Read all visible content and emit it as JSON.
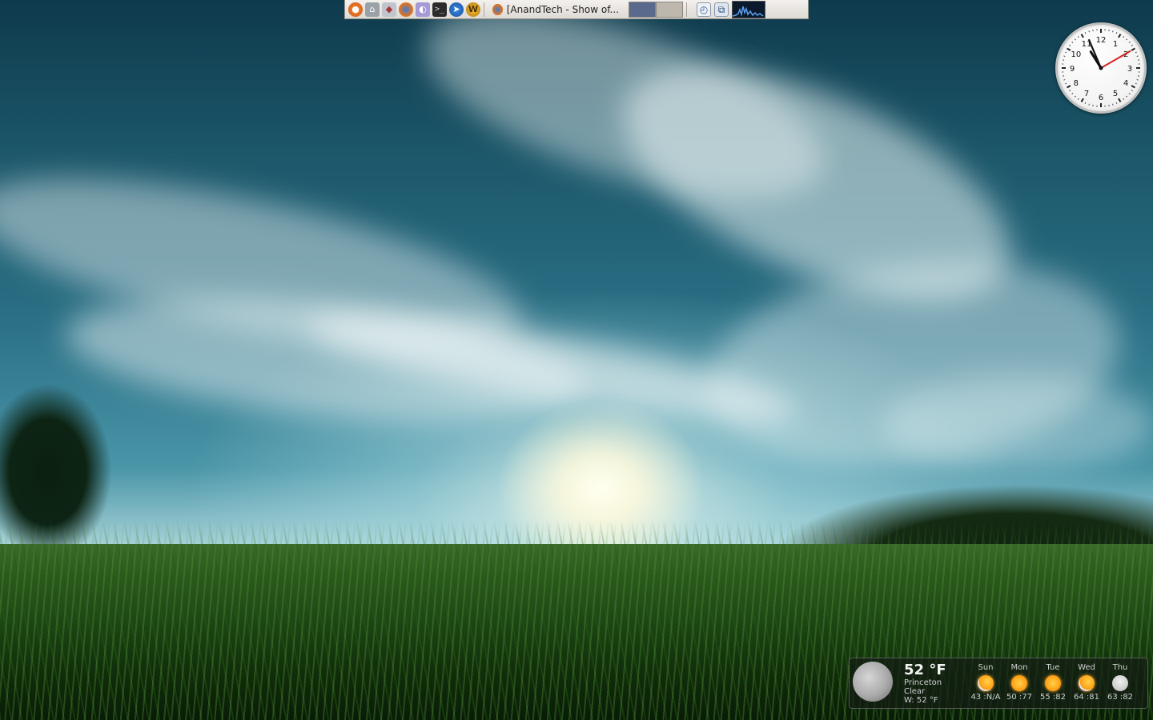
{
  "panel": {
    "launchers": [
      {
        "name": "ubuntu-menu-icon"
      },
      {
        "name": "home-folder-icon"
      },
      {
        "name": "network-places-icon"
      },
      {
        "name": "firefox-icon"
      },
      {
        "name": "pidgin-icon"
      },
      {
        "name": "terminal-icon"
      },
      {
        "name": "compass-browser-icon"
      },
      {
        "name": "world-of-warcraft-icon"
      }
    ],
    "task": {
      "icon": "firefox-icon",
      "title": "[AnandTech - Show of..."
    },
    "pager_colors": [
      "#5a6a8c",
      "#bdb7ae"
    ],
    "tray": [
      {
        "name": "clock-applet-icon"
      },
      {
        "name": "network-applet-icon"
      },
      {
        "name": "network-monitor-graph"
      }
    ]
  },
  "clock": {
    "numbers": [
      "12",
      "1",
      "2",
      "3",
      "4",
      "5",
      "6",
      "7",
      "8",
      "9",
      "10",
      "11"
    ],
    "time": {
      "hour": 10,
      "minute": 56,
      "second": 10
    }
  },
  "weather": {
    "current": {
      "temperature": "52 °F",
      "location": "Princeton",
      "condition": "Clear",
      "wind": "W: 52 °F",
      "icon": "moon-icon"
    },
    "forecast": [
      {
        "day": "Sun",
        "icon": "partly-cloudy-icon",
        "range": "43 :N/A"
      },
      {
        "day": "Mon",
        "icon": "sunny-icon",
        "range": "50 :77"
      },
      {
        "day": "Tue",
        "icon": "sunny-icon",
        "range": "55 :82"
      },
      {
        "day": "Wed",
        "icon": "partly-cloudy-icon",
        "range": "64 :81"
      },
      {
        "day": "Thu",
        "icon": "thunderstorm-icon",
        "range": "63 :82"
      }
    ]
  }
}
